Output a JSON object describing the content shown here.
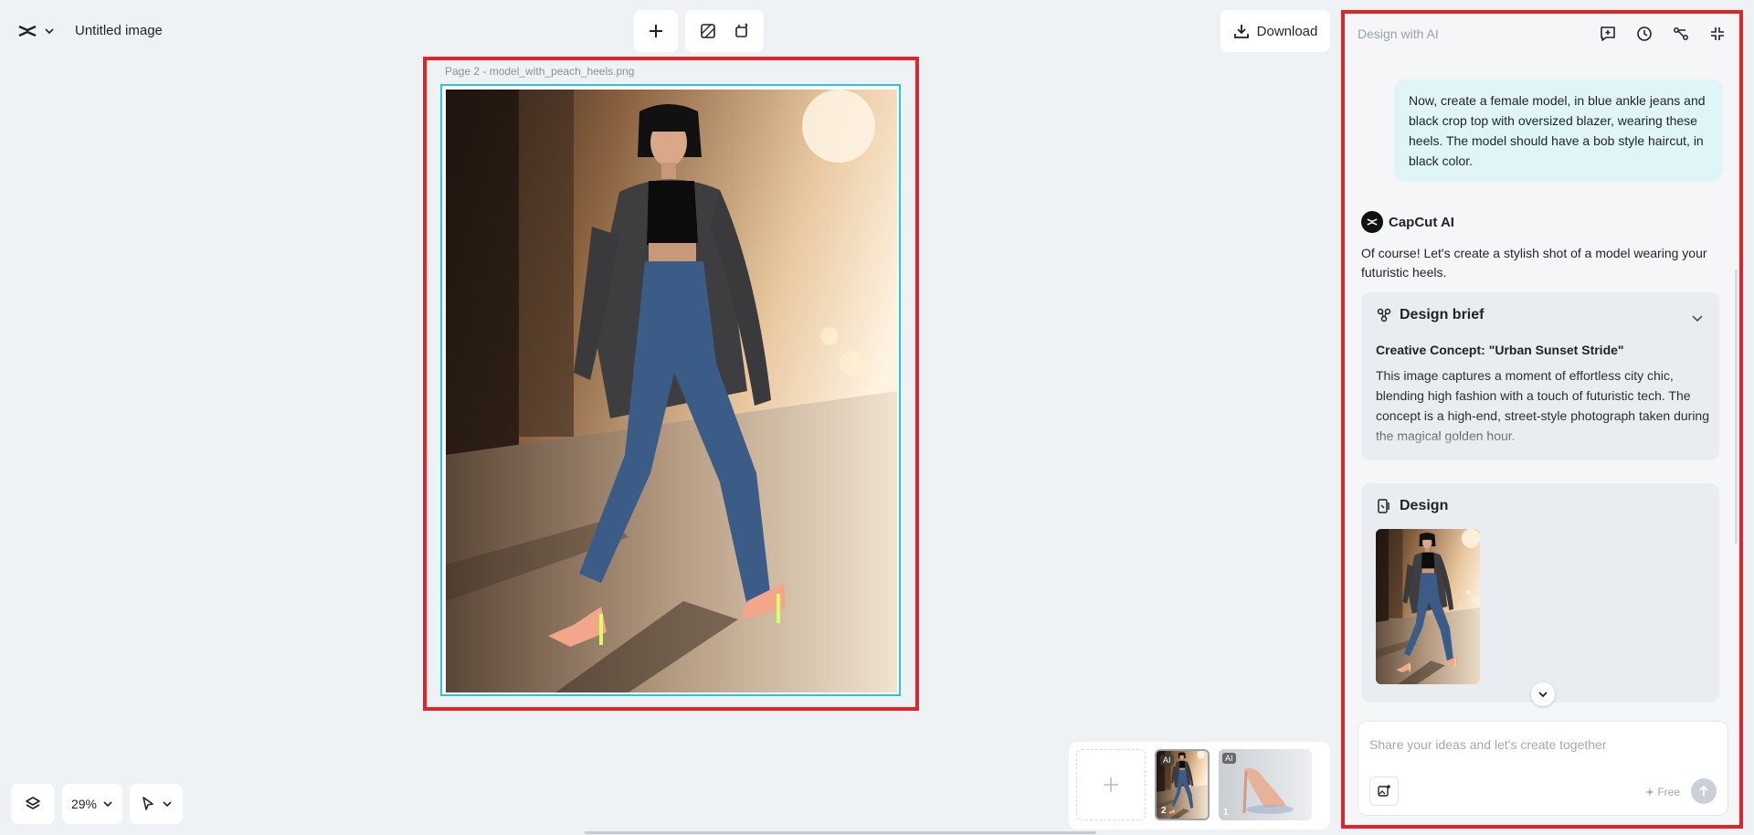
{
  "header": {
    "doc_title": "Untitled image",
    "download_label": "Download"
  },
  "canvas": {
    "page_label": "Page 2 -   model_with_peach_heels.png",
    "zoom": "29%"
  },
  "pages": [
    {
      "number": "2",
      "tag": "AI"
    },
    {
      "number": "1",
      "tag": "AI"
    }
  ],
  "ai_panel": {
    "title": "Design with AI",
    "user_message": "Now, create a female model, in blue ankle jeans and black crop top with oversized blazer, wearing these heels. The model should have a bob style haircut, in black color.",
    "assistant_name": "CapCut AI",
    "assistant_intro": "Of course! Let's create a stylish shot of a model wearing your futuristic heels.",
    "brief": {
      "title": "Design brief",
      "concept": "Creative Concept: \"Urban Sunset Stride\"",
      "body": "This image captures a moment of effortless city chic, blending high fashion with a touch of futuristic tech. The concept is a high-end, street-style photograph taken during the magical golden hour."
    },
    "design_title": "Design",
    "input_placeholder": "Share your ideas and let's create together",
    "free_label": "Free"
  },
  "colors": {
    "selection": "#e0242b",
    "page_border": "#27c7d6",
    "user_bubble": "#dff5f8"
  }
}
